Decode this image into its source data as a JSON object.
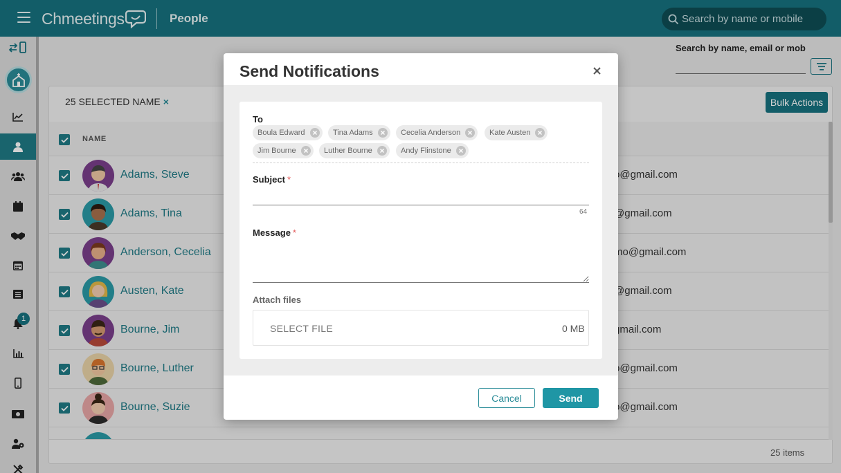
{
  "header": {
    "brand": "Chmeetings",
    "title": "People",
    "search_placeholder": "Search by name or mobile"
  },
  "sidebar": {
    "notification_count": "1",
    "items": [
      "switch-device",
      "dashboard",
      "people",
      "groups",
      "events",
      "contributions",
      "calendar",
      "forms",
      "notifications",
      "reports",
      "mobile-app",
      "finance",
      "volunteers",
      "settings"
    ]
  },
  "people_page": {
    "search_label": "Search by name, email or mobi",
    "selected_label": "25 SELECTED NAME",
    "clear_selection": "×",
    "bulk_actions": "Bulk Actions",
    "column_name": "NAME",
    "rows": [
      {
        "name": "Adams, Steve",
        "email": "o@gmail.com"
      },
      {
        "name": "Adams, Tina",
        "email": "@gmail.com"
      },
      {
        "name": "Anderson, Cecelia",
        "email": "mo@gmail.com"
      },
      {
        "name": "Austen, Kate",
        "email": "@gmail.com"
      },
      {
        "name": "Bourne, Jim",
        "email": "gmail.com"
      },
      {
        "name": "Bourne, Luther",
        "email": "o@gmail.com"
      },
      {
        "name": "Bourne, Suzie",
        "email": "o@gmail.com"
      }
    ],
    "items_count": "25 items"
  },
  "modal": {
    "title": "Send Notifications",
    "to_label": "To",
    "recipients": [
      "Boula Edward",
      "Tina Adams",
      "Cecelia Anderson",
      "Kate Austen",
      "Jim Bourne",
      "Luther Bourne",
      "Andy Flinstone"
    ],
    "subject_label": "Subject",
    "subject_value": "",
    "subject_counter": "64",
    "message_label": "Message",
    "message_value": "",
    "required_mark": "*",
    "attach_label": "Attach files",
    "select_file": "SELECT FILE",
    "file_size": "0 MB",
    "cancel": "Cancel",
    "send": "Send"
  },
  "colors": {
    "primary": "#17727f",
    "accent": "#1f96a5",
    "required": "#e45a5a"
  }
}
